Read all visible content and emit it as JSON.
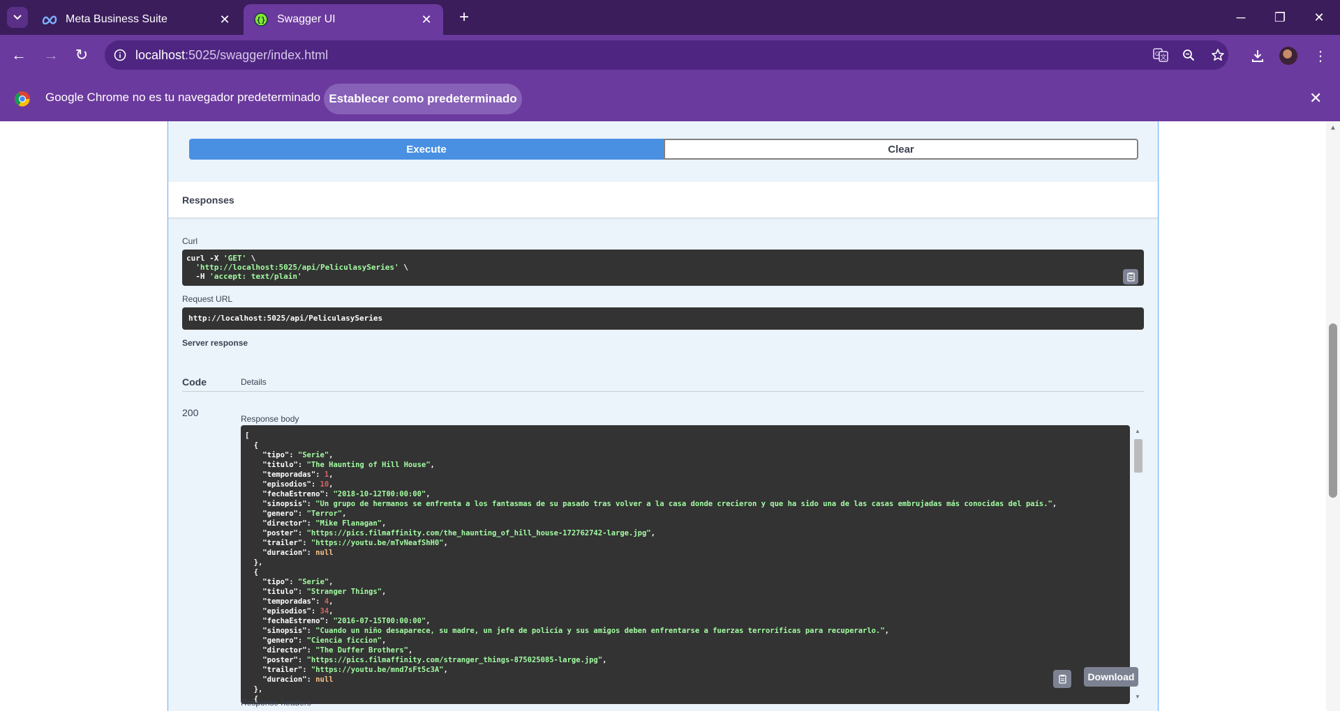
{
  "browser": {
    "tabs": [
      {
        "title": "Meta Business Suite",
        "active": false
      },
      {
        "title": "Swagger UI",
        "active": true
      }
    ],
    "url_host": "localhost",
    "url_path": ":5025/swagger/index.html",
    "infobar": {
      "message": "Google Chrome no es tu navegador predeterminado",
      "button": "Establecer como predeterminado"
    }
  },
  "swagger": {
    "execute_label": "Execute",
    "clear_label": "Clear",
    "responses_title": "Responses",
    "curl_label": "Curl",
    "curl_lines": [
      {
        "prefix": "curl -X ",
        "str": "'GET'",
        "suffix": " \\"
      },
      {
        "prefix": "  ",
        "str": "'http://localhost:5025/api/PeliculasySeries'",
        "suffix": " \\"
      },
      {
        "prefix": "  -H ",
        "str": "'accept: text/plain'",
        "suffix": ""
      }
    ],
    "request_url_label": "Request URL",
    "request_url": "http://localhost:5025/api/PeliculasySeries",
    "server_response_label": "Server response",
    "code_header": "Code",
    "details_header": "Details",
    "status_code": "200",
    "response_body_label": "Response body",
    "response_headers_label": "Response headers",
    "download_label": "Download",
    "response_items": [
      {
        "tipo": "Serie",
        "titulo": "The Haunting of Hill House",
        "temporadas": 1,
        "episodios": 10,
        "fechaEstreno": "2018-10-12T00:00:00",
        "sinopsis": "Un grupo de hermanos se enfrenta a los fantasmas de su pasado tras volver a la casa donde crecieron y que ha sido una de las casas embrujadas más conocidas del país.",
        "genero": "Terror",
        "director": "Mike Flanagan",
        "poster": "https://pics.filmaffinity.com/the_haunting_of_hill_house-172762742-large.jpg",
        "trailer": "https://youtu.be/mTvNeafShH0",
        "duracion": null
      },
      {
        "tipo": "Serie",
        "titulo": "Stranger Things",
        "temporadas": 4,
        "episodios": 34,
        "fechaEstreno": "2016-07-15T00:00:00",
        "sinopsis": "Cuando un niño desaparece, su madre, un jefe de policía y sus amigos deben enfrentarse a fuerzas terroríficas para recuperarlo.",
        "genero": "Ciencia ficcion",
        "director": "The Duffer Brothers",
        "poster": "https://pics.filmaffinity.com/stranger_things-875025085-large.jpg",
        "trailer": "https://youtu.be/mnd7sFt5c3A",
        "duracion": null
      }
    ]
  }
}
